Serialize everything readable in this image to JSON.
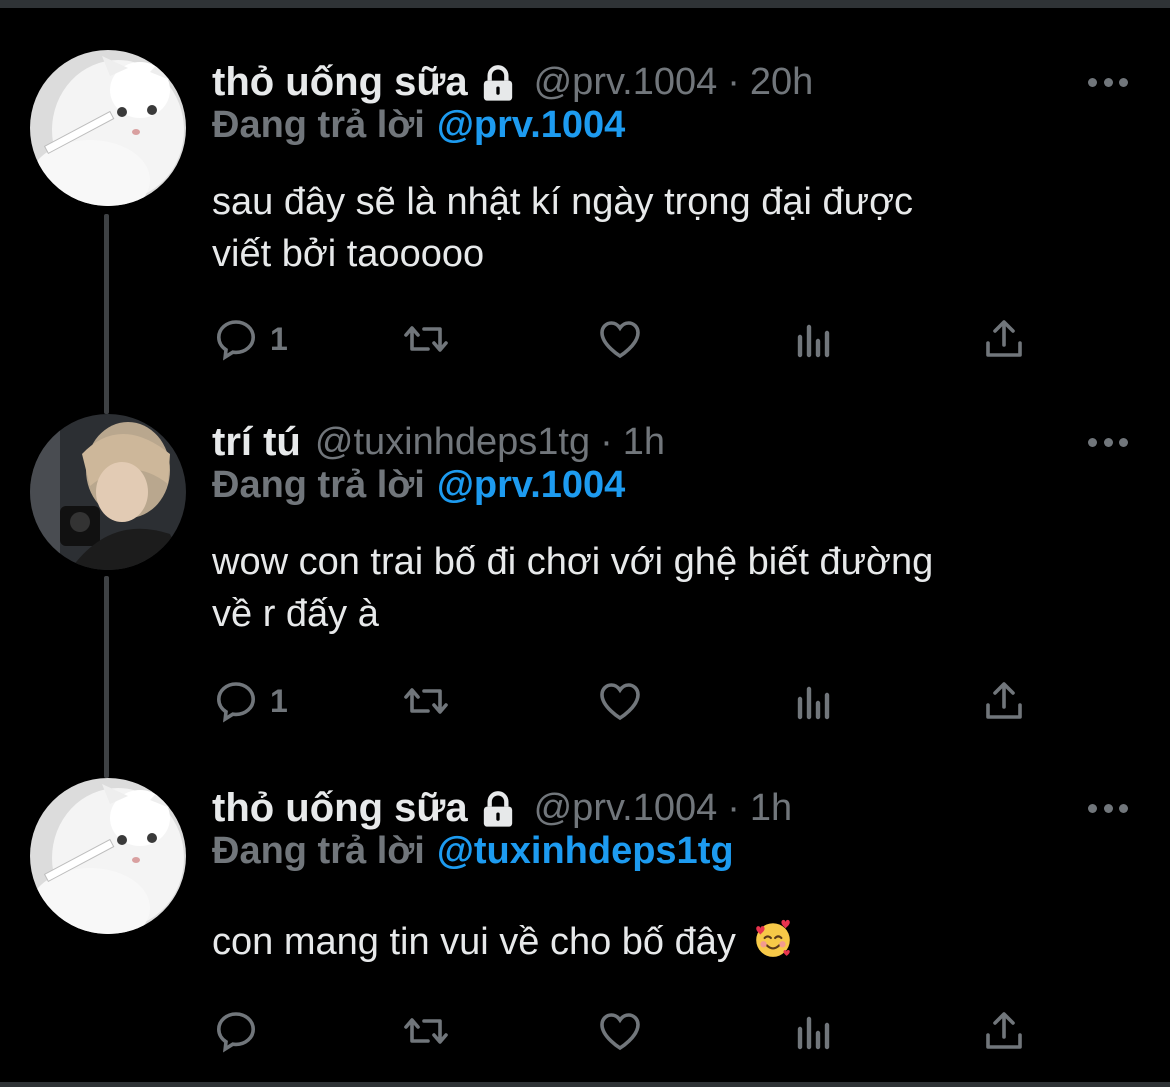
{
  "tweets": [
    {
      "name": "thỏ uống sữa",
      "locked": true,
      "handle": "@prv.1004",
      "separator": "·",
      "time": "20h",
      "reply_label": "Đang trả lời",
      "reply_mention": "@prv.1004",
      "text_lines": [
        "sau đây sẽ là nhật kí ngày trọng đại được",
        "viết bởi taooooo"
      ],
      "reply_count": "1",
      "avatar": "white-kitten-avatar"
    },
    {
      "name": "trí tú",
      "locked": false,
      "handle": "@tuxinhdeps1tg",
      "separator": "·",
      "time": "1h",
      "reply_label": "Đang trả lời",
      "reply_mention": "@prv.1004",
      "text_lines": [
        "wow con trai bố đi chơi với ghệ biết đường",
        "về r đấy à"
      ],
      "reply_count": "1",
      "avatar": "person-with-camera-avatar"
    },
    {
      "name": "thỏ uống sữa",
      "locked": true,
      "handle": "@prv.1004",
      "separator": "·",
      "time": "1h",
      "reply_label": "Đang trả lời",
      "reply_mention": "@tuxinhdeps1tg",
      "text_lines": [
        "con mang tin vui về cho bố đây"
      ],
      "text_emoji": "smiling-face-with-hearts",
      "reply_count": "",
      "avatar": "white-kitten-avatar"
    }
  ],
  "icons": {
    "reply": "reply-icon",
    "retweet": "retweet-icon",
    "like": "heart-icon",
    "views": "views-icon",
    "share": "share-icon",
    "more": "more-icon",
    "lock": "lock-icon"
  },
  "colors": {
    "background": "#000000",
    "text": "#e7e9ea",
    "muted": "#71767b",
    "link": "#1d9bf0",
    "thread_line": "#3e4144"
  }
}
